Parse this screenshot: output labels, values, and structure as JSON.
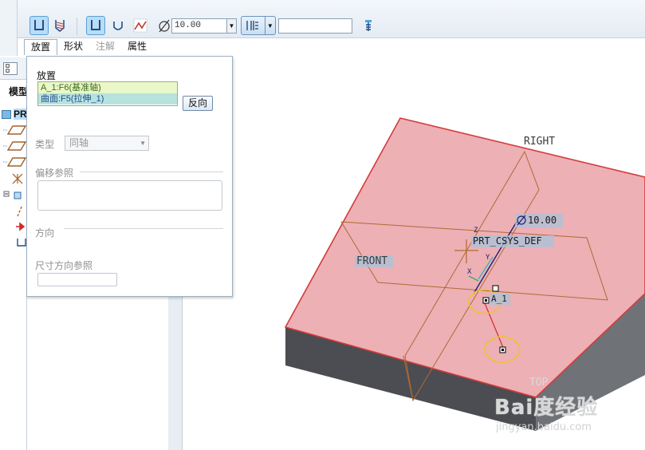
{
  "toolbar": {
    "diameter_symbol": "⌀",
    "diameter_value": "10.00",
    "extra_field_value": ""
  },
  "tabs": [
    {
      "label": "放置",
      "active": true
    },
    {
      "label": "形状",
      "active": false
    },
    {
      "label": "注解",
      "active": false,
      "disabled": true
    },
    {
      "label": "属性",
      "active": false
    }
  ],
  "model_tree": {
    "tab_label": "模型",
    "root_label": "PR"
  },
  "placement_panel": {
    "section_title": "放置",
    "references": [
      "A_1:F6(基准轴)",
      "曲面:F5(拉伸_1)"
    ],
    "flip_button": "反向",
    "type_label": "类型",
    "type_value": "同轴",
    "offset_refs_label": "偏移参照",
    "direction_label": "方向",
    "dim_direction_label": "尺寸方向参照"
  },
  "viewport": {
    "labels": {
      "right": "RIGHT",
      "front": "FRONT",
      "top": "TOP",
      "csys": "PRT_CSYS_DEF",
      "diameter_dim": "10.00",
      "axis": "A_1",
      "z": "Z",
      "y": "Y",
      "x": "X"
    },
    "colors": {
      "top_face": "#ecb0b5",
      "front_face": "#4b4d52",
      "side_face": "#6f7378",
      "datum_plane": "#b06a33",
      "axis": "#d22a2a",
      "hole_circle": "#f2c12e"
    }
  },
  "watermark": {
    "logo": "Bai度经验",
    "url": "jingyan.baidu.com"
  }
}
